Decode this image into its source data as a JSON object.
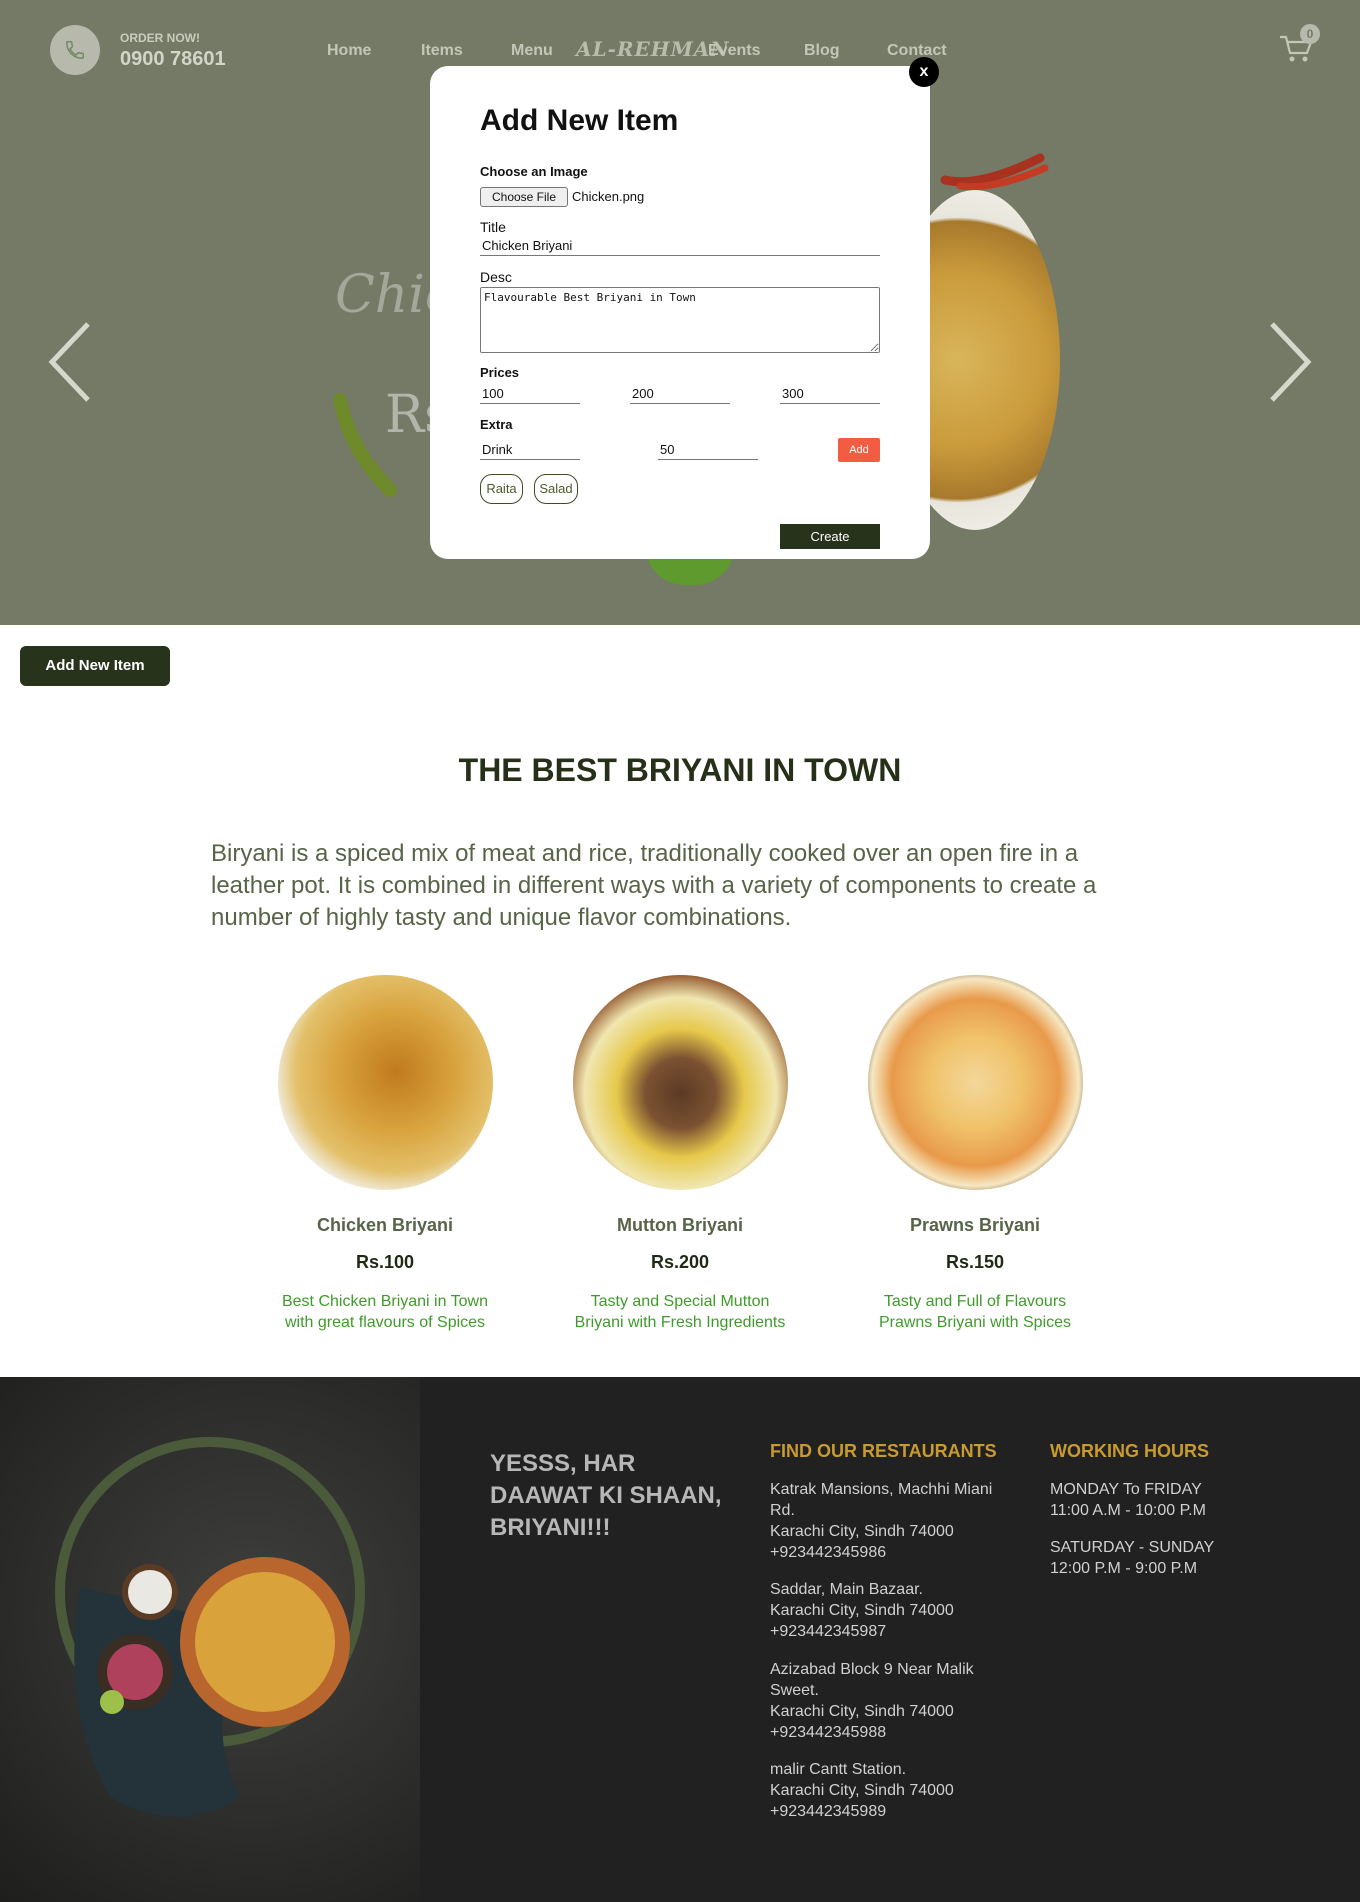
{
  "header": {
    "order_label": "ORDER NOW!",
    "phone": "0900 78601",
    "nav": [
      "Home",
      "Items",
      "Menu",
      "Events",
      "Blog",
      "Contact"
    ],
    "logo": "AL-REHMAN",
    "cart_count": "0"
  },
  "hero": {
    "script_text": "Chick",
    "price_text": "Rs"
  },
  "modal": {
    "close": "x",
    "title": "Add New Item",
    "image_label": "Choose an Image",
    "file_button": "Choose File",
    "file_name": "Chicken.png",
    "title_label": "Title",
    "title_value": "Chicken Briyani",
    "desc_label": "Desc",
    "desc_value": "Flavourable Best Briyani in Town",
    "prices_label": "Prices",
    "prices": [
      "100",
      "200",
      "300"
    ],
    "extra_label": "Extra",
    "extra_name": "Drink",
    "extra_price": "50",
    "add_button": "Add",
    "extras": [
      "Raita",
      "Salad"
    ],
    "create_button": "Create"
  },
  "add_new_item_button": "Add New Item",
  "section": {
    "title": "THE BEST BRIYANI IN TOWN",
    "description": "Biryani is a spiced mix of meat and rice, traditionally cooked over an open fire in a leather pot. It is combined in different ways with a variety of components to create a number of highly tasty and unique flavor combinations."
  },
  "items": [
    {
      "name": "Chicken Briyani",
      "price": "Rs.100",
      "desc": "Best Chicken Briyani in Town with great flavours of Spices"
    },
    {
      "name": "Mutton Briyani",
      "price": "Rs.200",
      "desc": "Tasty and Special Mutton Briyani with Fresh Ingredients"
    },
    {
      "name": "Prawns Briyani",
      "price": "Rs.150",
      "desc": "Tasty and Full of Flavours Prawns Briyani with Spices"
    }
  ],
  "footer": {
    "tagline": "YESSS, HAR DAAWAT KI SHAAN, BRIYANI!!!",
    "restaurants_heading": "FIND OUR RESTAURANTS",
    "restaurants": [
      {
        "line1": "Katrak Mansions, Machhi Miani Rd.",
        "line2": "Karachi City, Sindh 74000",
        "phone": "+923442345986"
      },
      {
        "line1": "Saddar, Main Bazaar.",
        "line2": "Karachi City, Sindh 74000",
        "phone": "+923442345987"
      },
      {
        "line1": "Azizabad Block 9 Near Malik Sweet.",
        "line2": "Karachi City, Sindh 74000",
        "phone": "+923442345988"
      },
      {
        "line1": "malir Cantt Station.",
        "line2": "Karachi City, Sindh 74000",
        "phone": "+923442345989"
      }
    ],
    "hours_heading": "WORKING HOURS",
    "hours": [
      {
        "days": "MONDAY To FRIDAY",
        "time": "11:00 A.M - 10:00 P.M"
      },
      {
        "days": "SATURDAY - SUNDAY",
        "time": "12:00 P.M - 9:00 P.M"
      }
    ]
  },
  "colors": {
    "hero_bg": "#747a65",
    "dark_green": "#28331c",
    "accent_red": "#f25c43",
    "footer_bg": "#212121",
    "footer_heading": "#c99a2e",
    "desc_green": "#3f9b2b"
  },
  "icons": [
    "phone-icon",
    "cart-icon",
    "arrow-left-icon",
    "arrow-right-icon"
  ]
}
